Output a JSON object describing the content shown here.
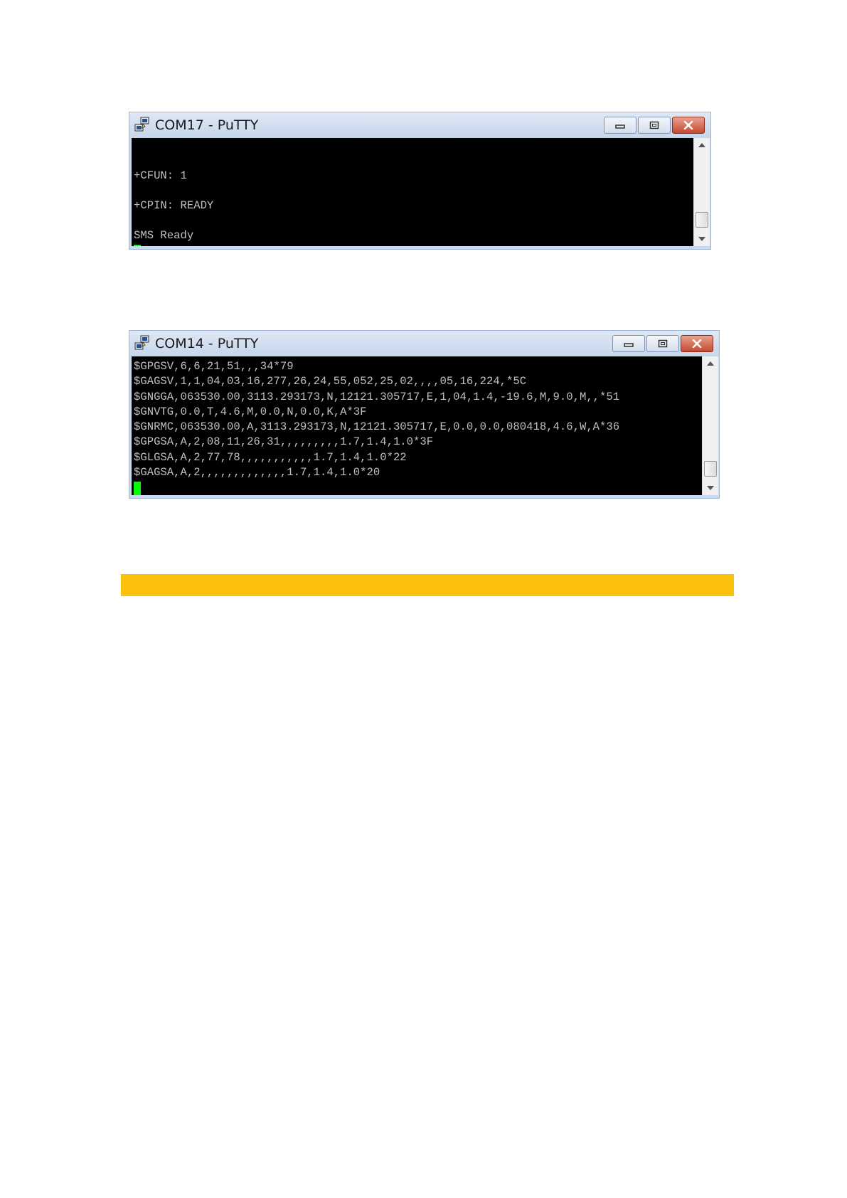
{
  "window1": {
    "title": "COM17 - PuTTY",
    "lines": [
      "",
      "+CFUN: 1",
      "",
      "+CPIN: READY",
      "",
      "SMS Ready"
    ]
  },
  "window2": {
    "title": "COM14 - PuTTY",
    "lines": [
      "$GPGSV,6,6,21,51,,,34*79",
      "$GAGSV,1,1,04,03,16,277,26,24,55,052,25,02,,,,05,16,224,*5C",
      "$GNGGA,063530.00,3113.293173,N,12121.305717,E,1,04,1.4,-19.6,M,9.0,M,,*51",
      "$GNVTG,0.0,T,4.6,M,0.0,N,0.0,K,A*3F",
      "$GNRMC,063530.00,A,3113.293173,N,12121.305717,E,0.0,0.0,080418,4.6,W,A*36",
      "$GPGSA,A,2,08,11,26,31,,,,,,,,,1.7,1.4,1.0*3F",
      "$GLGSA,A,2,77,78,,,,,,,,,,,1.7,1.4,1.0*22",
      "$GAGSA,A,2,,,,,,,,,,,,,1.7,1.4,1.0*20"
    ]
  },
  "colors": {
    "terminal_bg": "#000000",
    "terminal_fg": "#c0c0c0",
    "cursor": "#00ff00",
    "titlebar": "#c9d9ee",
    "highlight_bar": "#fcc10c"
  },
  "icons": {
    "app": "putty-icon",
    "minimize": "minimize-icon",
    "maximize": "maximize-icon",
    "close": "close-icon",
    "scroll_up": "scroll-up-arrow-icon",
    "scroll_down": "scroll-down-arrow-icon"
  }
}
